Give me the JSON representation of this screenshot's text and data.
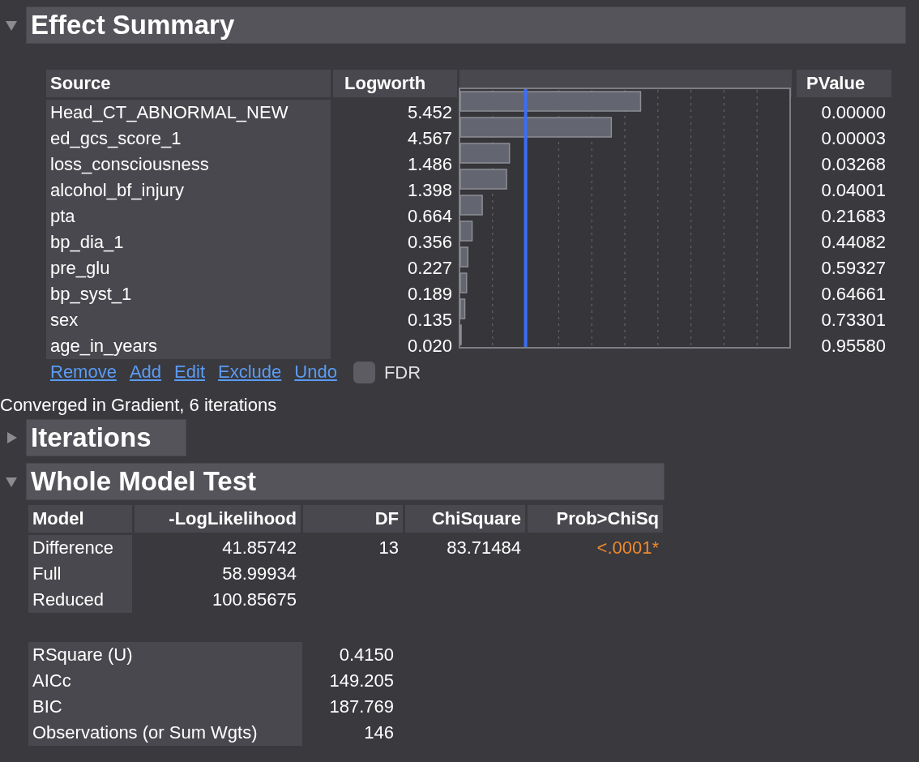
{
  "effect_summary": {
    "title": "Effect Summary",
    "expanded": true,
    "columns": [
      "Source",
      "Logworth",
      "PValue"
    ],
    "rows": [
      {
        "source": "Head_CT_ABNORMAL_NEW",
        "logworth": "5.452",
        "level": 0.5452,
        "pvalue": "0.00000"
      },
      {
        "source": "ed_gcs_score_1",
        "logworth": "4.567",
        "level": 0.4567,
        "pvalue": "0.00003"
      },
      {
        "source": "loss_consciousness",
        "logworth": "1.486",
        "level": 0.1486,
        "pvalue": "0.03268"
      },
      {
        "source": "alcohol_bf_injury",
        "logworth": "1.398",
        "level": 0.1398,
        "pvalue": "0.04001"
      },
      {
        "source": "pta",
        "logworth": "0.664",
        "level": 0.0664,
        "pvalue": "0.21683"
      },
      {
        "source": "bp_dia_1",
        "logworth": "0.356",
        "level": 0.0356,
        "pvalue": "0.44082"
      },
      {
        "source": "pre_glu",
        "logworth": "0.227",
        "level": 0.0227,
        "pvalue": "0.59327"
      },
      {
        "source": "bp_syst_1",
        "logworth": "0.189",
        "level": 0.0189,
        "pvalue": "0.64661"
      },
      {
        "source": "sex",
        "logworth": "0.135",
        "level": 0.0135,
        "pvalue": "0.73301"
      },
      {
        "source": "age_in_years",
        "logworth": "0.020",
        "level": 0.002,
        "pvalue": "0.95580"
      }
    ],
    "links": [
      "Remove",
      "Add",
      "Edit",
      "Exclude",
      "Undo"
    ],
    "fdr": {
      "label": "FDR",
      "checked": false
    }
  },
  "status": "Converged in Gradient, 6 iterations",
  "iterations": {
    "title": "Iterations",
    "expanded": false
  },
  "whole_model_test": {
    "title": "Whole Model Test",
    "expanded": true,
    "columns": [
      "Model",
      "-LogLikelihood",
      "DF",
      "ChiSquare",
      "Prob>ChiSq"
    ],
    "rows": [
      {
        "model": "Difference",
        "loglik": "41.85742",
        "df": "13",
        "chisquare": "83.71484",
        "prob": "<.0001*",
        "significant": true
      },
      {
        "model": "Full",
        "loglik": "58.99934"
      },
      {
        "model": "Reduced",
        "loglik": "100.85675"
      }
    ],
    "summary": [
      {
        "label": "RSquare (U)",
        "value": "0.4150"
      },
      {
        "label": "AICc",
        "value": "149.205"
      },
      {
        "label": "BIC",
        "value": "187.769"
      },
      {
        "label": "Observations (or Sum Wgts)",
        "value": "146"
      }
    ]
  }
}
